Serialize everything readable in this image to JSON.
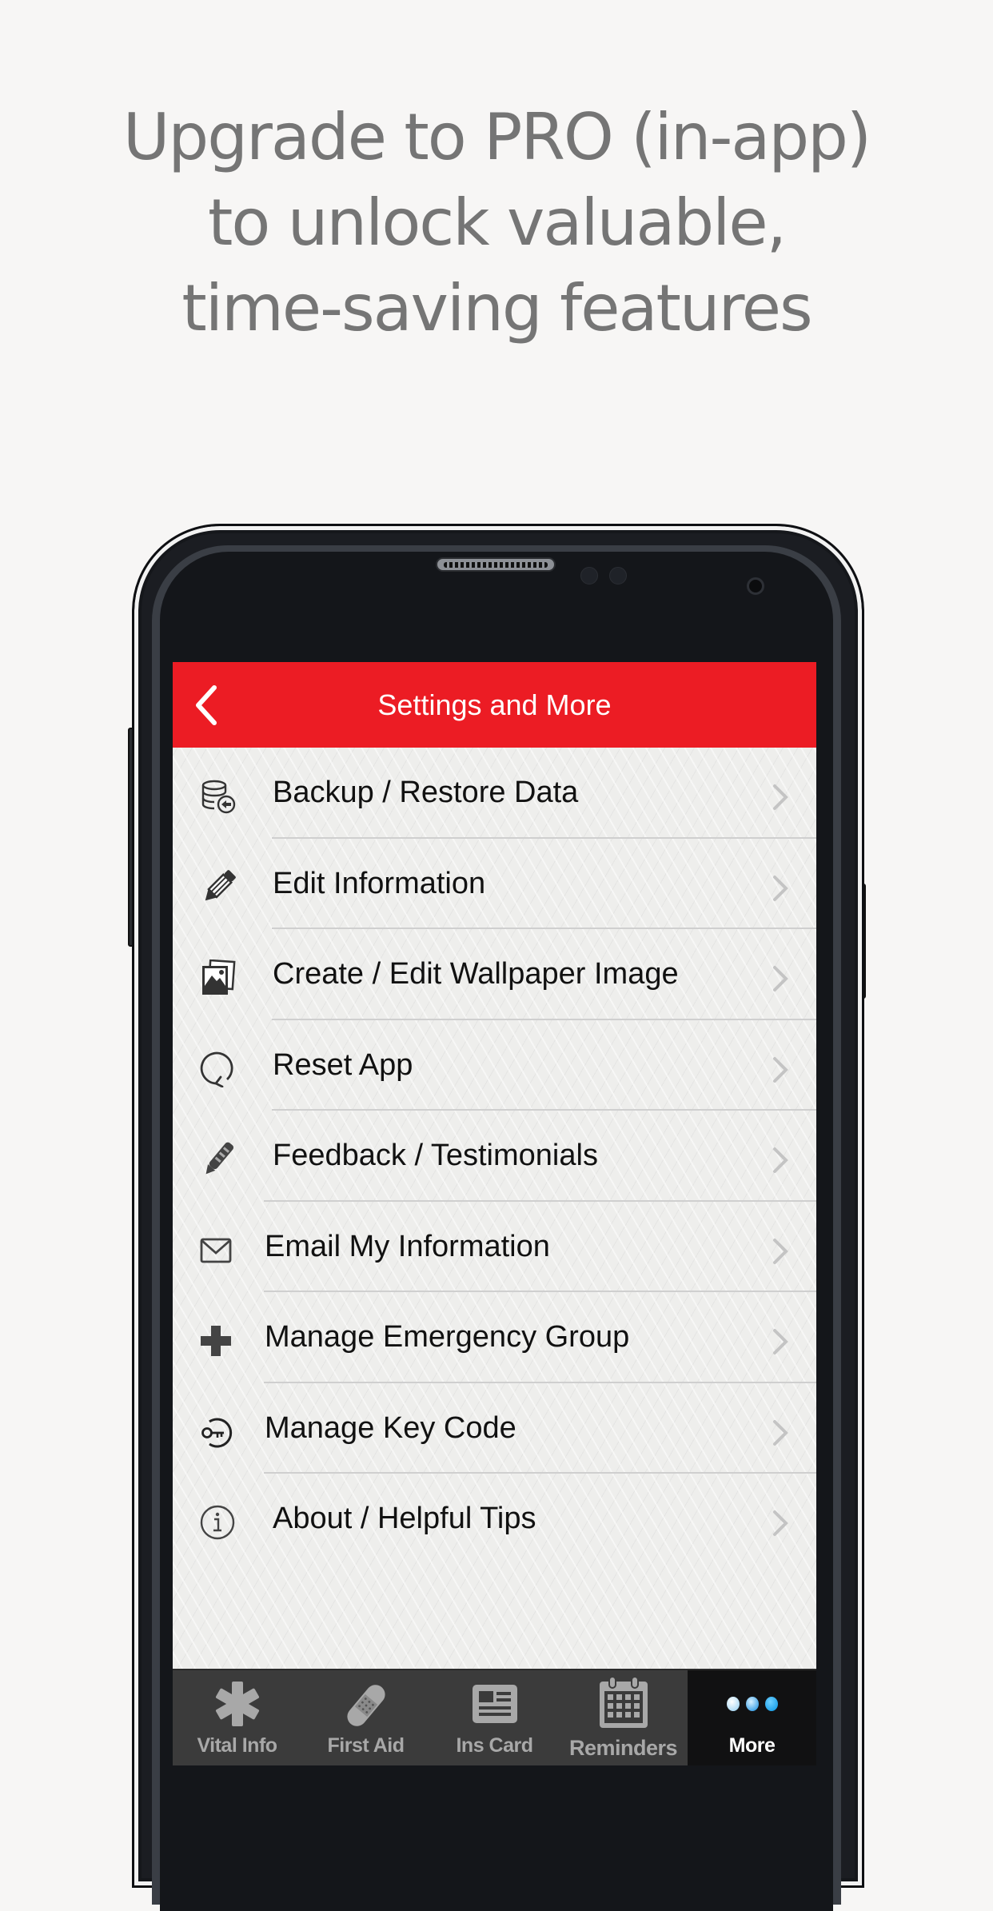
{
  "headline": {
    "lines": [
      "Upgrade to PRO (in-app)",
      "to unlock valuable,",
      "time-saving features"
    ]
  },
  "app": {
    "header": {
      "title": "Settings and More",
      "back_icon": "chevron-left-icon"
    },
    "menu": [
      {
        "label": "Backup / Restore Data",
        "icon": "database-restore-icon"
      },
      {
        "label": "Edit Information",
        "icon": "pencil-icon"
      },
      {
        "label": "Create / Edit Wallpaper Image",
        "icon": "photos-icon"
      },
      {
        "label": "Reset App",
        "icon": "refresh-icon"
      },
      {
        "label": "Feedback / Testimonials",
        "icon": "pen-icon"
      },
      {
        "label": "Email My Information",
        "icon": "envelope-icon"
      },
      {
        "label": "Manage Emergency Group",
        "icon": "plus-cross-icon"
      },
      {
        "label": "Manage Key Code",
        "icon": "key-icon"
      },
      {
        "label": "About / Helpful Tips",
        "icon": "info-icon"
      }
    ],
    "tabs": [
      {
        "label": "Vital Info",
        "icon": "star-of-life-icon",
        "active": false
      },
      {
        "label": "First Aid",
        "icon": "bandage-icon",
        "active": false
      },
      {
        "label": "Ins Card",
        "icon": "id-card-icon",
        "active": false
      },
      {
        "label": "Reminders",
        "icon": "calendar-icon",
        "active": false
      },
      {
        "label": "More",
        "icon": "more-dots-icon",
        "active": true
      }
    ],
    "colors": {
      "header": "#ec1c24",
      "tabbar": "#3b3b3b",
      "active_tab": "#111112",
      "more_dots": "#29b6f6"
    }
  }
}
